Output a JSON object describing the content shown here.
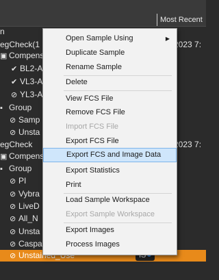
{
  "header": {
    "sort_label": "Most Recent"
  },
  "tree": [
    {
      "label": "n",
      "indent": 0,
      "icon": ""
    },
    {
      "label": "egCheck(1",
      "indent": 0,
      "icon": "",
      "date": "2023 7:"
    },
    {
      "label": "Compens",
      "indent": 1,
      "icon": "compensation-icon"
    },
    {
      "label": "BL2-A",
      "indent": 2,
      "icon": "check-icon",
      "icon_glyph": "✔"
    },
    {
      "label": "VL3-A",
      "indent": 2,
      "icon": "check-icon",
      "icon_glyph": "✔"
    },
    {
      "label": "YL3-A",
      "indent": 2,
      "icon": "gate-icon",
      "icon_glyph": "⊘"
    },
    {
      "label": "Group",
      "indent": 0,
      "icon": "group-icon"
    },
    {
      "label": "Samp",
      "indent": 1,
      "icon": "gate-icon",
      "icon_glyph": "⊘"
    },
    {
      "label": "Unsta",
      "indent": 1,
      "icon": "gate-icon",
      "icon_glyph": "⊘"
    },
    {
      "label": "egCheck",
      "indent": 0,
      "icon": "",
      "date": "2023 7:"
    },
    {
      "label": "Compens",
      "indent": 1,
      "icon": "compensation-icon"
    },
    {
      "label": "Group",
      "indent": 1,
      "icon": "group-icon"
    },
    {
      "label": "PI",
      "indent": 2,
      "icon": "gate-icon",
      "icon_glyph": "⊘"
    },
    {
      "label": "Vybra",
      "indent": 2,
      "icon": "gate-icon",
      "icon_glyph": "⊘"
    },
    {
      "label": "LiveD",
      "indent": 2,
      "icon": "gate-icon",
      "icon_glyph": "⊘"
    },
    {
      "label": "All_N",
      "indent": 2,
      "icon": "gate-icon",
      "icon_glyph": "⊘"
    },
    {
      "label": "Unsta",
      "indent": 2,
      "icon": "gate-icon",
      "icon_glyph": "⊘"
    },
    {
      "label": "Caspa",
      "indent": 2,
      "icon": "gate-icon",
      "icon_glyph": "⊘"
    },
    {
      "label": "Unstained_Use",
      "indent": 2,
      "icon": "gate-icon",
      "icon_glyph": "⊘",
      "selected": true,
      "badge": "IS"
    }
  ],
  "menu": {
    "items": [
      {
        "label": "Open Sample Using",
        "submenu": true
      },
      {
        "label": "Duplicate Sample"
      },
      {
        "label": "Rename Sample"
      },
      {
        "label": "Delete"
      },
      {
        "label": "View FCS File"
      },
      {
        "label": "Remove FCS File"
      },
      {
        "label": "Import FCS File",
        "disabled": true
      },
      {
        "label": "Export FCS File"
      },
      {
        "label": "Export FCS and Image Data",
        "highlight": true
      },
      {
        "label": "Export Statistics"
      },
      {
        "label": "Print"
      },
      {
        "label": "Load Sample Workspace"
      },
      {
        "label": "Export Sample Workspace",
        "disabled": true
      },
      {
        "label": "Export Images"
      },
      {
        "label": "Process Images"
      }
    ]
  },
  "colors": {
    "selected_row": "#e88a1a",
    "menu_highlight": "#cfe6fb",
    "badge_dot": "#3b8ee8"
  }
}
